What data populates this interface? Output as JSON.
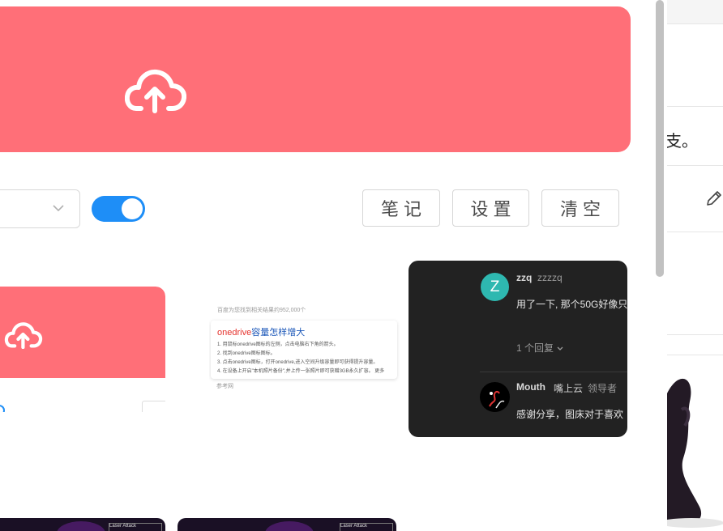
{
  "toolbar": {
    "select_value": "",
    "toggle_on": true,
    "note_label": "笔记",
    "settings_label": "设置",
    "clear_label": "清空"
  },
  "colors": {
    "accent_pink": "#ff6f78",
    "toggle_blue": "#1e8ef7",
    "dark_card": "#222222"
  },
  "icons": {
    "upload": "cloud-upload-icon",
    "dropdown": "chevron-down-icon",
    "edit": "pencil-icon"
  },
  "thumbnails": {
    "search_result": {
      "header": "百度为您找到相关结果约952,000个",
      "title_red": "onedrive",
      "title_blue": "容量怎样增大",
      "lines": [
        "1. 用鼠标onedrive图标的左侧，点击电脑右下角的箭头。",
        "2. 找到onedrive图标图标。",
        "3. 点击onedrive图标，打开onedrive,进入空间升级容量即可获得提升容量。",
        "4. 在设备上开启\"本机照片备份\",并上传一张照片即可获赠3GB永久扩容。 更多"
      ],
      "footer": "参考网"
    },
    "comments": {
      "comment1": {
        "avatar_letter": "Z",
        "user": "zzq",
        "handle": "zzzzq",
        "text": "用了一下, 那个50G好像只",
        "replies": "1 个回复"
      },
      "comment2": {
        "user": "Mouth",
        "nickname": "嘴上云",
        "role": "领导者",
        "text": "感谢分享，图床对于喜欢"
      }
    },
    "game_hud": "Laser Attack"
  },
  "side_page": {
    "text_fragment": "支。"
  }
}
